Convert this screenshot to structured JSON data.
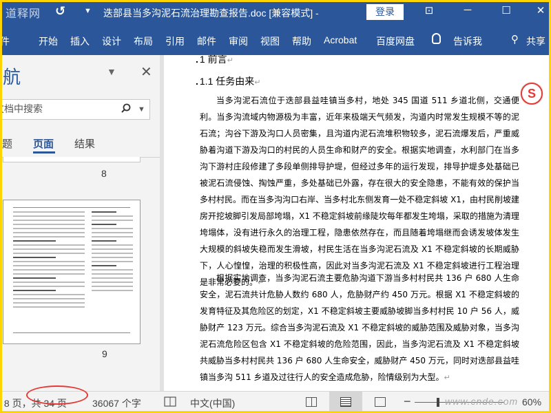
{
  "window": {
    "logo_text": "道释网",
    "title": "迭部县当多沟泥石流治理勘查报告.doc [兼容模式]  -",
    "login_label": "登录"
  },
  "ribbon": {
    "tabs": [
      "文件",
      "开始",
      "插入",
      "设计",
      "布局",
      "引用",
      "邮件",
      "审阅",
      "视图",
      "帮助",
      "Acrobat",
      "百度网盘"
    ],
    "tell_me": "告诉我",
    "share": "共享"
  },
  "nav": {
    "title": "导航",
    "search_placeholder": "在文档中搜索",
    "tabs": [
      "标题",
      "页面",
      "结果"
    ],
    "active_tab": "页面",
    "page_before": "8",
    "page_current": "9"
  },
  "document": {
    "heading1": "1 前言",
    "heading2": "1.1 任务由来",
    "para1": "当多沟泥石流位于迭部县益哇镇当多村，地处 345 国道 511 乡道北侧，交通便利。当多沟流域内物源极为丰富，近年来极端天气频发，沟道内时常发生规模不等的泥石流；沟谷下游及沟口人员密集，且沟道内泥石流堆积物较多，泥石流爆发后，严重威胁着沟道下游及沟口的村民的人员生命和财产的安全。根据实地调查，水利部门在当多沟下游村庄段修建了多段单侧排导护堤，但经过多年的运行发现，排导护堤多处基础已被泥石流侵蚀、掏蚀严重，多处基础已外露，存在很大的安全隐患，不能有效的保护当多村村民。而在当多沟沟口右岸、当多村北东侧发育一处不稳定斜坡 X1，由村民削坡建房开挖坡脚引发局部垮塌，X1 不稳定斜坡前缘陡坎每年都发生垮塌，采取的措施为清理垮塌体，没有进行永久的治理工程，隐患依然存在，而且随着垮塌继而会诱发坡体发生大规模的斜坡失稳而发生滑坡，村民生活在当多沟泥石流及 X1 不稳定斜坡的长期威胁下，人心惶惶，治理的积极性高，因此对当多沟泥石流及 X1 不稳定斜坡进行工程治理是非常必要的。",
    "para2": "根据实地调查，当多沟泥石流主要危胁沟道下游当多村村民共 136 户 680 人生命安全，泥石流共计危胁人数约 680 人，危胁财产约 450 万元。根据 X1 不稳定斜坡的发育特征及其危险区的划定，X1 不稳定斜坡主要威胁坡脚当多村村民 10 户 56 人，威胁财产 123 万元。综合当多沟泥石流及 X1 不稳定斜坡的威胁范围及威胁对象，当多沟泥石流危险区包含 X1 不稳定斜坡的危险范围，因此，当多沟泥石流及 X1 不稳定斜坡共威胁当多村村民共 136 户 680 人生命安全，威胁财产 450 万元，同时对迭部县益哇镇当多沟 511 乡道及过往行人的安全造成危胁，险情级别为大型。",
    "badge": "S"
  },
  "status": {
    "page_info": "第 8 页，共 34 页",
    "word_count": "36067 个字",
    "language": "中文(中国)",
    "watermark": "www.cnde.com",
    "zoom": "60%"
  },
  "colors": {
    "word_blue": "#2b579a",
    "frame_yellow": "#ffd400",
    "annotation_red": "#e53935"
  }
}
